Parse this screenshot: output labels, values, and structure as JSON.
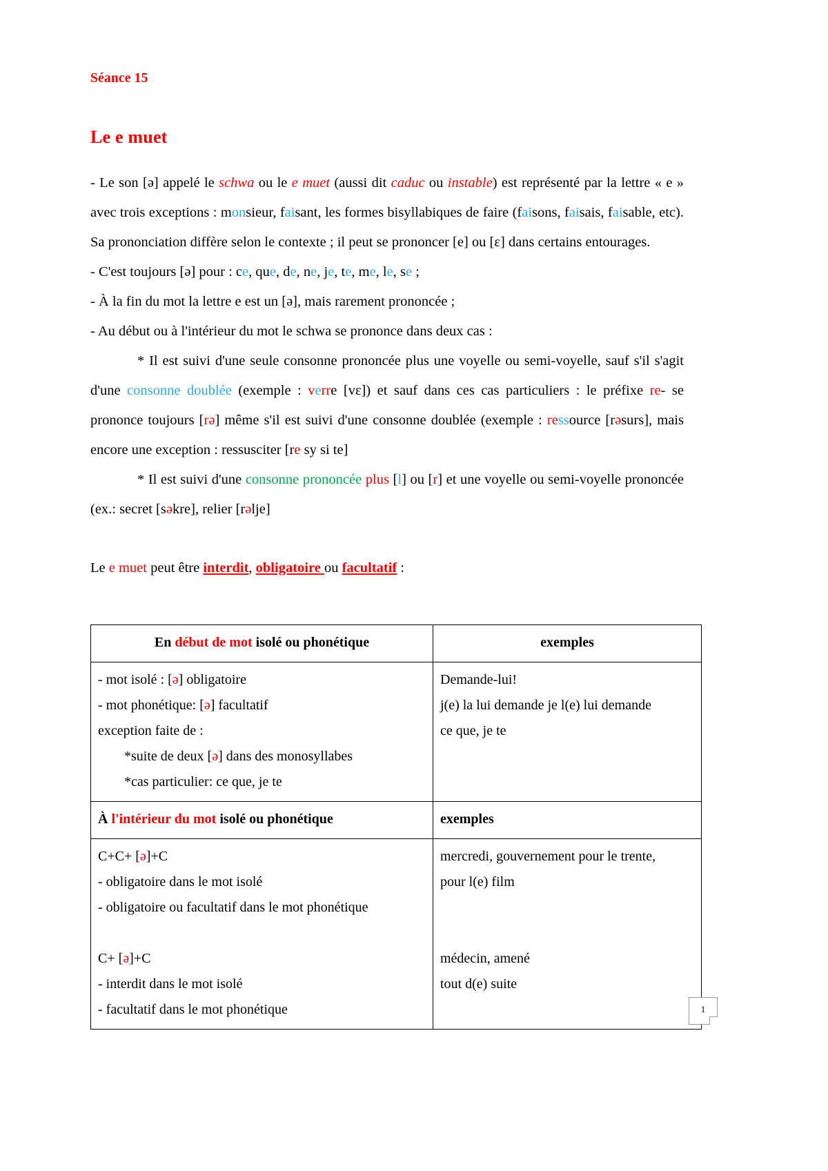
{
  "document": {
    "seance_label": "Séance 15",
    "title": "Le e muet",
    "page_number": "1"
  },
  "colors": {
    "red": "#ff0000",
    "cyan": "#29abe2",
    "green": "#00a651",
    "text": "#000000"
  },
  "paragraphs": {
    "p1": {
      "s1": "- Le son [ə] appelé le ",
      "schwa": "schwa",
      "s2": " ou le ",
      "e_muet": "e muet",
      "s3": " (aussi dit ",
      "caduc": "caduc",
      "s4": " ou ",
      "instable": "instable",
      "s5": ") est représenté par la lettre « e » avec trois exceptions : m",
      "on1": "on",
      "s6": "sieur, f",
      "ai1": "ai",
      "s7": "sant, les formes bisyllabiques de faire (f",
      "ai2": "ai",
      "s8": "sons, f",
      "ai3": "ai",
      "s9": "sais, f",
      "ai4": "ai",
      "s10": "sable, etc). Sa prononciation diffère selon le contexte ; il peut se prononcer [e] ou [ɛ] dans certains entourages."
    },
    "p2": {
      "s1": "- C'est toujours [ə] pour : c",
      "e1": "e",
      "s2": ", qu",
      "e2": "e",
      "s3": ", d",
      "e3": "e",
      "s4": ", n",
      "e4": "e",
      "s5": ", j",
      "e5": "e",
      "s6": ", t",
      "e6": "e",
      "s7": ", m",
      "e7": "e",
      "s8": ", l",
      "e8": "e",
      "s9": ", s",
      "e9": "e",
      "s10": " ;"
    },
    "p3": "- À la fin du mot la lettre e est un [ə], mais rarement prononcée ;",
    "p4": "- Au début ou à l'intérieur du mot le schwa se prononce dans deux cas :",
    "p5": {
      "s1": "* Il est suivi d'une seule consonne prononcée plus une voyelle ou semi-voyelle, sauf s'il s'agit d'une ",
      "consonne_doublee": "consonne doublée",
      "s2": " (exemple : ",
      "v": "v",
      "e_cyan": "e",
      "rr": "rr",
      "s3": "e [vɛ]) et sauf dans ces cas particuliers : le préfixe ",
      "re": "re",
      "s4": "- se prononce toujours [",
      "r_red": "r",
      "schwa_red": "ə",
      "s5": "] même s'il est suivi d'une consonne doublée (exemple : ",
      "re2": "re",
      "ss": "ss",
      "s6": "ource [r",
      "schwa_red2": "ə",
      "s7": "surs], mais encore une exception : ressusciter [r",
      "e_red": "e",
      "s8": " sy si te]"
    },
    "p6": {
      "s1": "* Il est suivi d'une ",
      "consonne_prononcee": "consonne prononcée",
      "s2": " ",
      "plus": "plus",
      "s3": " [",
      "l_cyan": "l",
      "s4": "] ou [",
      "r_red": "r",
      "s5": "] et une voyelle ou semi-voyelle prononcée (ex.: secret [s",
      "schwa1": "ə",
      "s6": "kre], relier [r",
      "schwa2": "ə",
      "s7": "lje]"
    },
    "p7": {
      "s1": "Le ",
      "e_muet": "e muet",
      "s2": " peut être ",
      "interdit": "interdit",
      "s3": ", ",
      "obligatoire": "obligatoire ",
      "s4": "ou ",
      "facultatif": "facultatif",
      "s5": " :"
    }
  },
  "table": {
    "section1": {
      "header_left_part1": "En ",
      "header_left_red": "début de mot",
      "header_left_part2": " isolé ou phonétique",
      "header_right": "exemples",
      "rows": [
        {
          "left_lines": [
            {
              "pre": "- mot isolé : [",
              "schwa": "ə",
              "post": "] obligatoire"
            },
            {
              "pre": "- mot phonétique: [",
              "schwa": "ə",
              "post": "] facultatif"
            },
            {
              "pre": "exception faite de :",
              "schwa": "",
              "post": ""
            }
          ],
          "left_sub_lines": [
            {
              "pre": "*suite de deux [",
              "schwa": "ə",
              "post": "] dans des monosyllabes"
            },
            {
              "pre": "*cas particulier: ce que, je te",
              "schwa": "",
              "post": ""
            }
          ],
          "right_lines": [
            "Demande-lui!",
            "j(e) la lui demande je l(e) lui demande",
            "ce que, je te"
          ]
        }
      ]
    },
    "section2": {
      "header_left_part1": "À ",
      "header_left_red": "l'intérieur du mot",
      "header_left_part2": " isolé ou phonétique",
      "header_right": "exemples",
      "rows": [
        {
          "left_group1": [
            {
              "pre": "C+C+ [",
              "schwa": "ə",
              "post": "]+C"
            },
            {
              "pre": "- obligatoire dans le mot isolé",
              "schwa": "",
              "post": ""
            },
            {
              "pre": "- obligatoire ou facultatif dans le mot phonétique",
              "schwa": "",
              "post": ""
            }
          ],
          "left_group2": [
            {
              "pre": "C+ [",
              "schwa": "ə",
              "post": "]+C"
            },
            {
              "pre": "- interdit dans le mot isolé",
              "schwa": "",
              "post": ""
            },
            {
              "pre": "- facultatif dans le mot phonétique",
              "schwa": "",
              "post": ""
            }
          ],
          "right_group1": [
            "mercredi, gouvernement pour le trente,",
            "pour l(e) film"
          ],
          "right_group2": [
            "médecin, amené",
            "tout d(e) suite"
          ]
        }
      ]
    }
  }
}
